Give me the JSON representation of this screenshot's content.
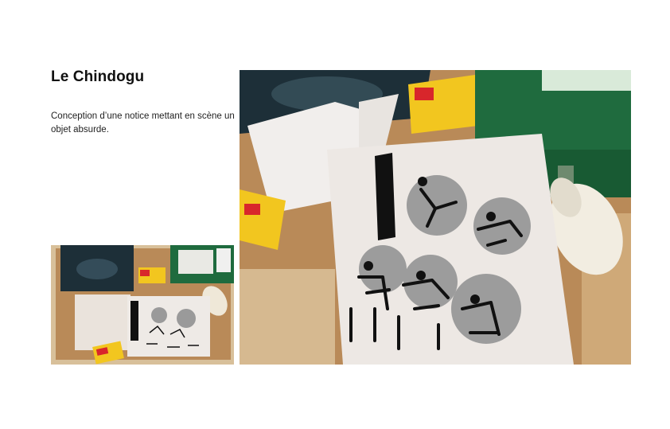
{
  "page": {
    "title": "Le Chindogu",
    "description": "Conception d’une notice mettant en scène un objet absurde."
  },
  "images": {
    "small_photo": "overhead photo of a corkboard with x-ray film, medicine box, bandage and printed instruction sheet",
    "large_photo": "close-up photo of the instruction sheet with pictogram figures, medicine box, bandage roll and green first-aid case"
  },
  "colors": {
    "cork": "#b98a58",
    "wood_frame": "#d6b990",
    "xray": "#1d2f38",
    "first_aid_green": "#1f6b3e",
    "medicine_yellow": "#f2c61f",
    "medicine_red": "#d8262b",
    "sheet": "#ede8e4"
  }
}
